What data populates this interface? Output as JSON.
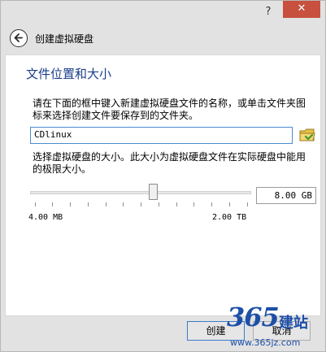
{
  "titlebar": {
    "help_label": "?",
    "close_label": "✕"
  },
  "header": {
    "title": "创建虚拟硬盘"
  },
  "section": {
    "title": "文件位置和大小",
    "description": "请在下面的框中键入新建虚拟硬盘文件的名称，或单击文件夹图标来选择创建文件要保存到的文件夹。",
    "size_description": "选择虚拟硬盘的大小。此大小为虚拟硬盘文件在实际硬盘中能用的极限大小。"
  },
  "file": {
    "value": "CDlinux"
  },
  "size": {
    "value": "8.00 GB",
    "min_label": "4.00 MB",
    "max_label": "2.00 TB",
    "slider_fraction": 0.56
  },
  "buttons": {
    "create": "创建",
    "cancel": "取消"
  },
  "watermark": {
    "brand": "365",
    "suffix": "建站",
    "url": "www.365jz.com"
  },
  "colors": {
    "accent": "#1a3e8c",
    "close": "#c7503e",
    "focus": "#4b8bd1"
  }
}
